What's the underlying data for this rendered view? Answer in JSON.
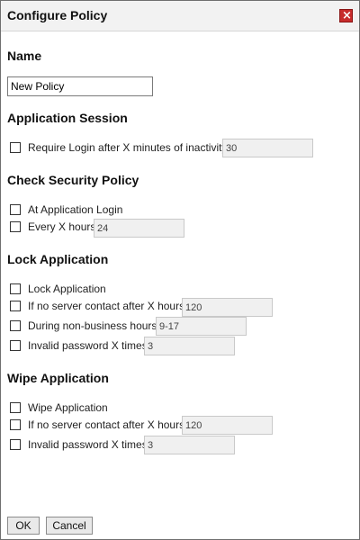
{
  "dialog": {
    "title": "Configure Policy",
    "close_label": "×"
  },
  "name_section": {
    "heading": "Name",
    "value": "New Policy"
  },
  "app_session": {
    "heading": "Application Session",
    "items": [
      {
        "label": "Require Login after X minutes of inactivity",
        "value": "30",
        "checked": false
      }
    ]
  },
  "security_policy": {
    "heading": "Check Security Policy",
    "items": [
      {
        "label": "At Application Login",
        "checked": false
      },
      {
        "label": "Every X hours",
        "value": "24",
        "checked": false
      }
    ]
  },
  "lock_app": {
    "heading": "Lock Application",
    "items": [
      {
        "label": "Lock Application",
        "checked": false
      },
      {
        "label": "If no server contact after X hours",
        "value": "120",
        "checked": false
      },
      {
        "label": "During non-business hours",
        "value": "9-17",
        "checked": false
      },
      {
        "label": "Invalid password X times",
        "value": "3",
        "checked": false
      }
    ]
  },
  "wipe_app": {
    "heading": "Wipe Application",
    "items": [
      {
        "label": "Wipe Application",
        "checked": false
      },
      {
        "label": "If no server contact after X hours",
        "value": "120",
        "checked": false
      },
      {
        "label": "Invalid password X times",
        "value": "3",
        "checked": false
      }
    ]
  },
  "buttons": {
    "ok": "OK",
    "cancel": "Cancel"
  },
  "colors": {
    "close_button": "#c72b2b",
    "titlebar": "#f2f2f2",
    "disabled_field": "#f0f0f0"
  }
}
